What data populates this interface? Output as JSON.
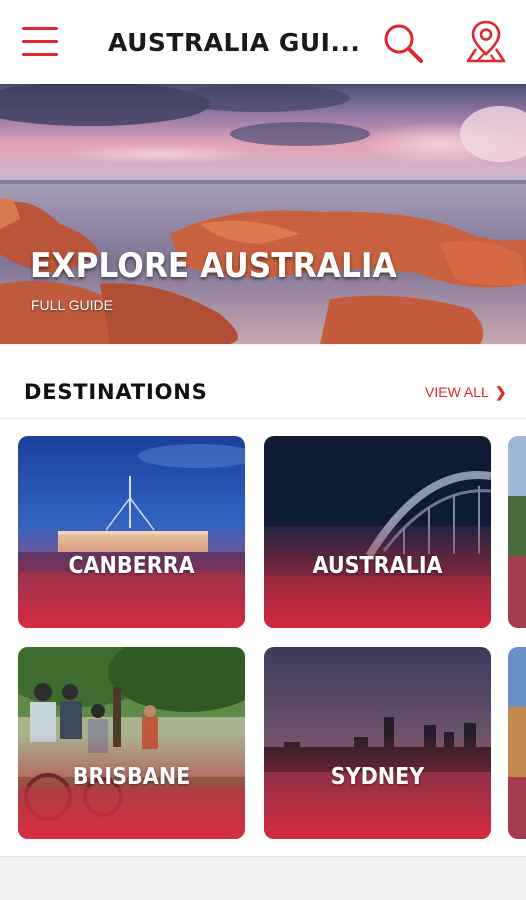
{
  "appbar": {
    "title": "AUSTRALIA GUI...",
    "icons": [
      "menu-icon",
      "search-icon",
      "map-pin-icon"
    ],
    "accent_color": "#e2262c"
  },
  "hero": {
    "title": "EXPLORE AUSTRALIA",
    "subtitle": "FULL GUIDE"
  },
  "destinations": {
    "heading": "DESTINATIONS",
    "view_all_label": "VIEW ALL",
    "view_all_icon": "chevron-right-icon",
    "cards": [
      {
        "label": "CANBERRA"
      },
      {
        "label": "AUSTRALIA"
      },
      {
        "label": "BRISBANE"
      },
      {
        "label": "SYDNEY"
      }
    ]
  }
}
